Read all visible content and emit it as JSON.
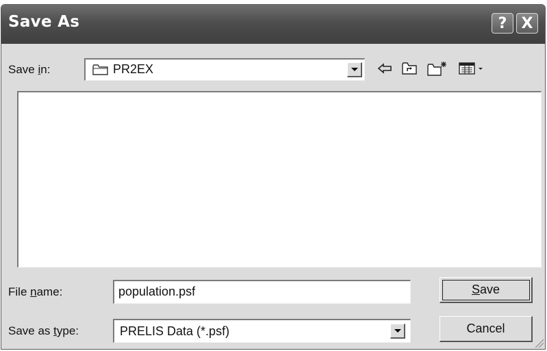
{
  "window": {
    "title": "Save As",
    "help_label": "?",
    "close_label": "X"
  },
  "save_in": {
    "label_pre": "Save ",
    "label_key": "i",
    "label_post": "n:",
    "value": "PR2EX"
  },
  "toolbar": {
    "icons": [
      "back-arrow-icon",
      "up-one-level-icon",
      "new-folder-icon",
      "view-menu-icon"
    ]
  },
  "file_name": {
    "label_pre": "File ",
    "label_key": "n",
    "label_post": "ame:",
    "value": "population.psf"
  },
  "save_as_type": {
    "label_pre": "Save as ",
    "label_key": "t",
    "label_post": "ype:",
    "value": "PRELIS Data (*.psf)"
  },
  "buttons": {
    "save_key": "S",
    "save_rest": "ave",
    "cancel": "Cancel"
  },
  "colors": {
    "title_bar": "#4e4e4e",
    "dialog_bg": "#dcdcdc"
  }
}
